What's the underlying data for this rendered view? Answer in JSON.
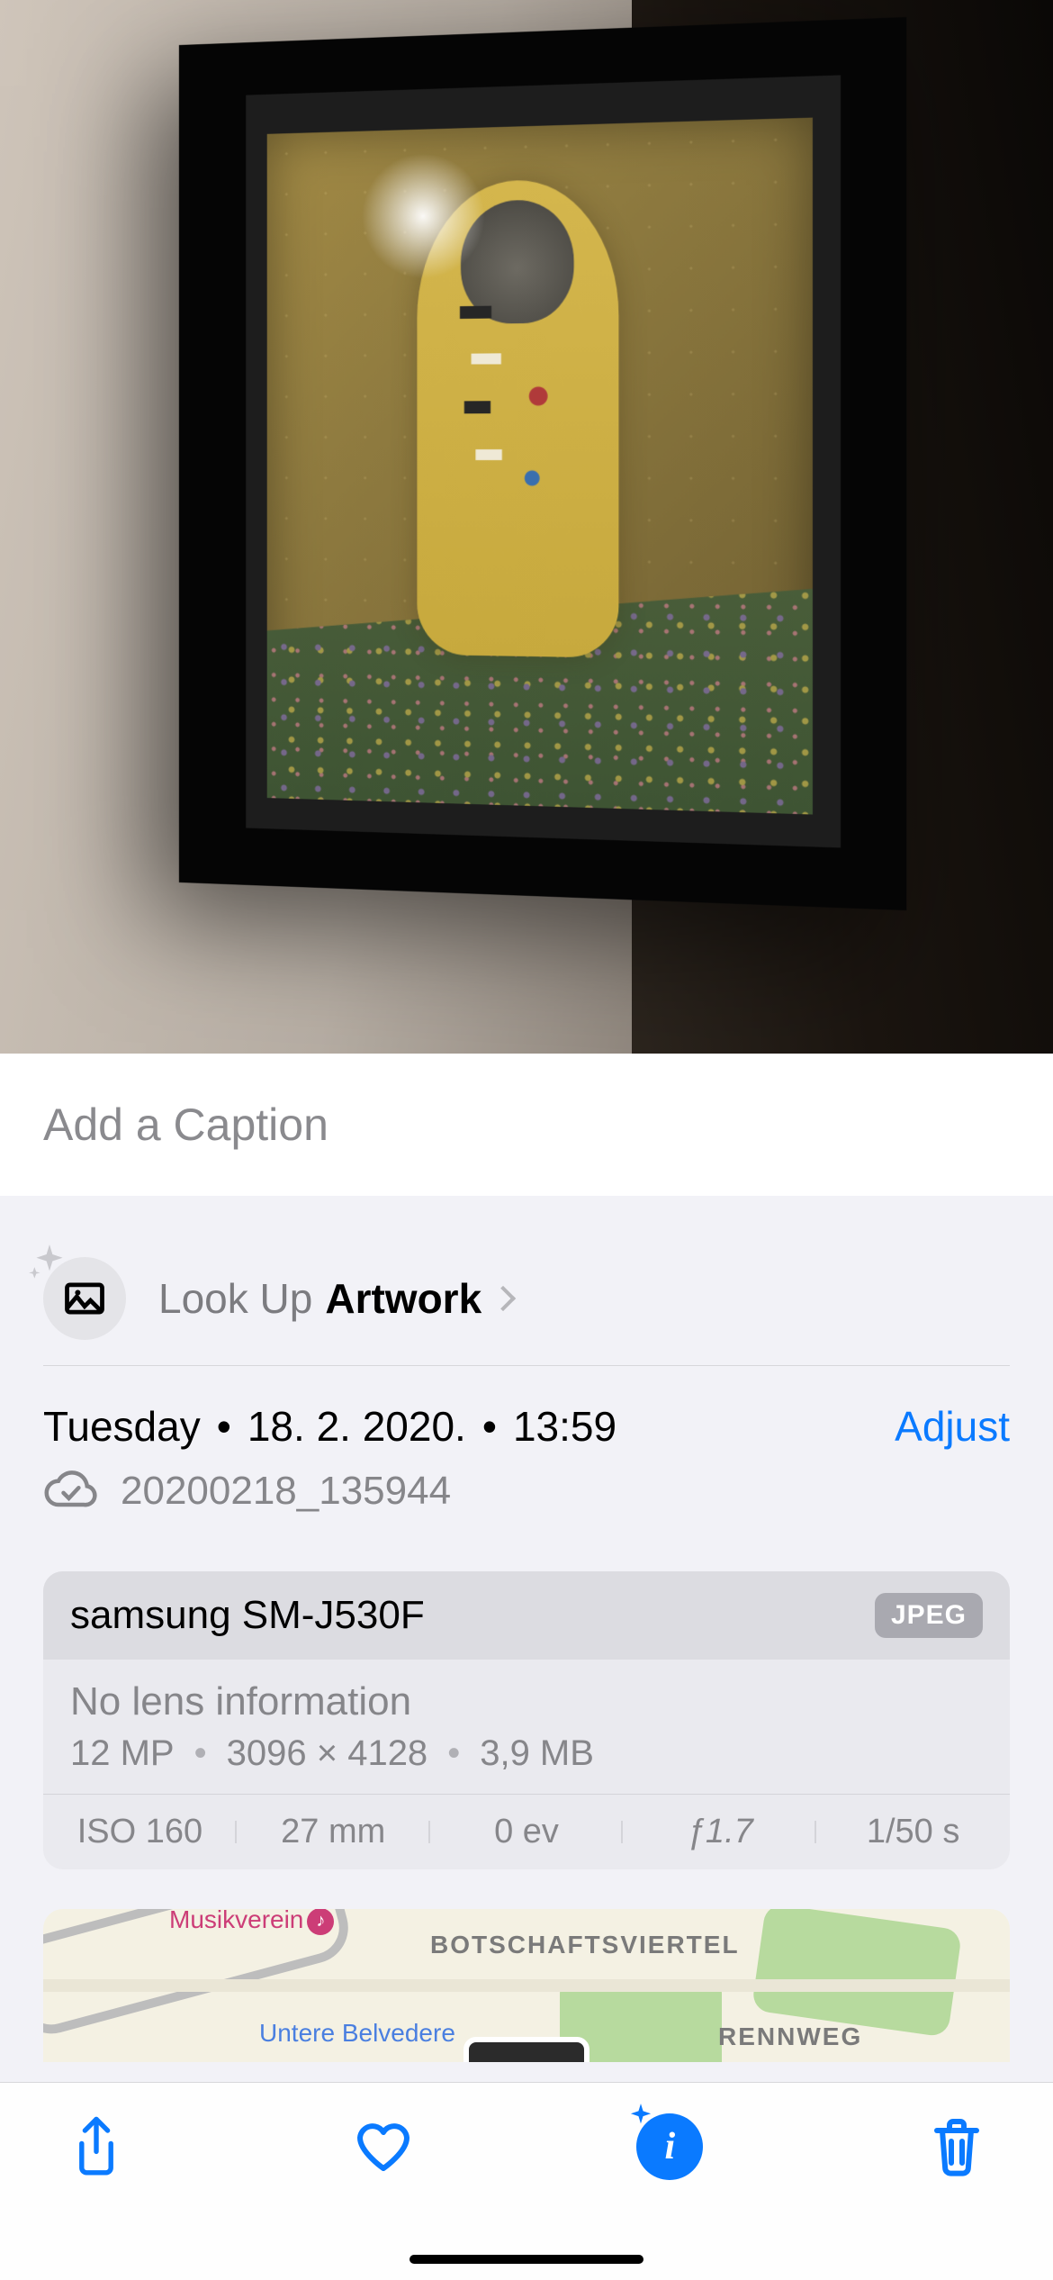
{
  "caption": {
    "placeholder": "Add a Caption"
  },
  "lookup": {
    "prefix": "Look Up",
    "subject": "Artwork"
  },
  "date": {
    "weekday": "Tuesday",
    "date": "18. 2. 2020.",
    "time": "13:59",
    "adjust_label": "Adjust",
    "cloud_filename": "20200218_135944"
  },
  "camera": {
    "model": "samsung SM-J530F",
    "format_badge": "JPEG",
    "lens": "No lens information",
    "megapixels": "12 MP",
    "resolution": "3096 × 4128",
    "filesize": "3,9 MB",
    "iso": "ISO 160",
    "focal_length": "27 mm",
    "exposure_bias": "0 ev",
    "aperture": "ƒ1.7",
    "shutter": "1/50 s"
  },
  "map": {
    "district1": "BOTSCHAFTSVIERTEL",
    "district2": "RENNWEG",
    "poi1": "Musikverein",
    "poi2": "Untere Belvedere"
  },
  "icons": {
    "share": "share-icon",
    "favorite": "heart-icon",
    "info": "info-icon",
    "delete": "trash-icon",
    "cloud": "cloud-check-icon",
    "lookup_badge": "picture-icon",
    "sparkle": "sparkle-icon",
    "chevron": "chevron-right-icon"
  }
}
